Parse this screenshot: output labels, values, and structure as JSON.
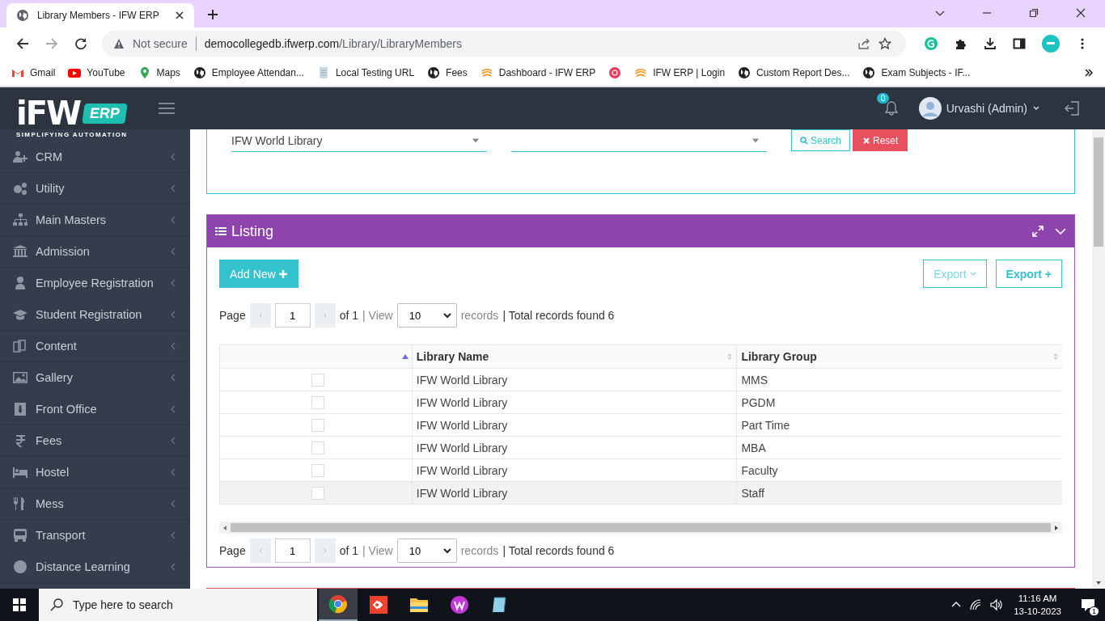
{
  "browser": {
    "tab_title": "Library Members - IFW ERP",
    "security": "Not secure",
    "url_host": "democollegedb.ifwerp.com",
    "url_path": "/Library/LibraryMembers",
    "bookmarks": [
      {
        "label": "Gmail"
      },
      {
        "label": "YouTube"
      },
      {
        "label": "Maps"
      },
      {
        "label": "Employee Attendan..."
      },
      {
        "label": "Local Testing URL"
      },
      {
        "label": "Fees"
      },
      {
        "label": "Dashboard - IFW ERP"
      },
      {
        "label": "IFW ERP | Login"
      },
      {
        "label": "Custom Report Des..."
      },
      {
        "label": "Exam Subjects - IF..."
      }
    ]
  },
  "header": {
    "logo_word": "iFW",
    "logo_badge": "ERP",
    "logo_tagline": "SIMPLIFYING AUTOMATION",
    "notification_count": "0",
    "user": "Urvashi (Admin)"
  },
  "sidebar": {
    "items": [
      {
        "label": "CRM"
      },
      {
        "label": "Utility"
      },
      {
        "label": "Main Masters"
      },
      {
        "label": "Admission"
      },
      {
        "label": "Employee Registration"
      },
      {
        "label": "Student Registration"
      },
      {
        "label": "Content"
      },
      {
        "label": "Gallery"
      },
      {
        "label": "Front Office"
      },
      {
        "label": "Fees"
      },
      {
        "label": "Hostel"
      },
      {
        "label": "Mess"
      },
      {
        "label": "Transport"
      },
      {
        "label": "Distance Learning"
      }
    ]
  },
  "filter": {
    "library": "IFW World Library",
    "search_button": "Search",
    "reset_button": "Reset"
  },
  "listing": {
    "title": "Listing",
    "add_button": "Add New",
    "export_menu": "Export",
    "export_plus": "Export +",
    "pagers": [
      {
        "page_label": "Page",
        "page": "1",
        "of": "of 1",
        "view": "| View",
        "size": "10",
        "records": "records",
        "total": "| Total records found 6"
      },
      {
        "page_label": "Page",
        "page": "1",
        "of": "of 1",
        "view": "| View",
        "size": "10",
        "records": "records",
        "total": "| Total records found 6"
      }
    ],
    "columns": [
      "",
      "Library Name",
      "Library Group"
    ],
    "rows": [
      {
        "checked": false,
        "hovered": false,
        "library": "IFW World Library",
        "group": "MMS"
      },
      {
        "checked": false,
        "hovered": false,
        "library": "IFW World Library",
        "group": "PGDM"
      },
      {
        "checked": false,
        "hovered": false,
        "library": "IFW World Library",
        "group": "Part Time"
      },
      {
        "checked": false,
        "hovered": false,
        "library": "IFW World Library",
        "group": "MBA"
      },
      {
        "checked": false,
        "hovered": false,
        "library": "IFW World Library",
        "group": "Faculty"
      },
      {
        "checked": false,
        "hovered": true,
        "library": "IFW World Library",
        "group": "Staff"
      }
    ]
  },
  "taskbar": {
    "search_placeholder": "Type here to search",
    "time": "11:16 AM",
    "date": "13-10-2023",
    "notifications": "1"
  }
}
